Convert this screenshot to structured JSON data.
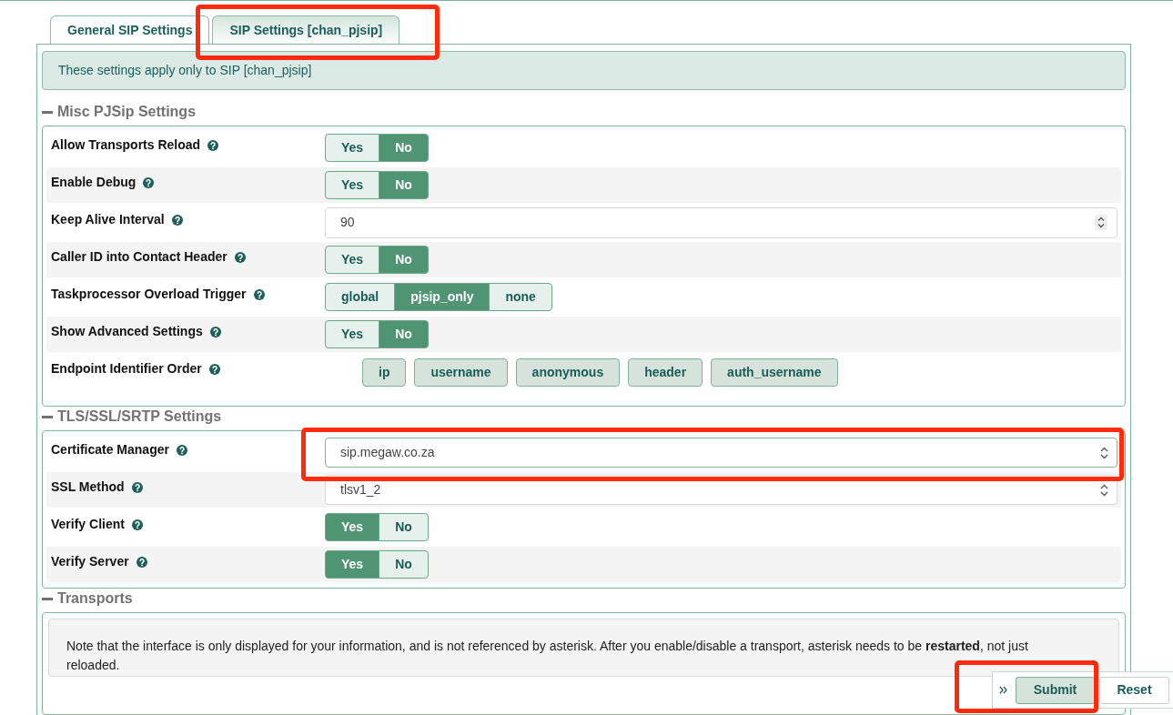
{
  "tabs": [
    {
      "label": "General SIP Settings",
      "selected": false,
      "highlighted": false
    },
    {
      "label": "SIP Settings [chan_pjsip]",
      "selected": true,
      "highlighted": true
    }
  ],
  "info_message": "These settings apply only to SIP [chan_pjsip]",
  "sections": [
    {
      "title": "Misc PJSip Settings",
      "expanded": true,
      "rows": [
        {
          "kind": "toggle",
          "label": "Allow Transports Reload",
          "highlighted": false,
          "options": [
            {
              "label": "Yes",
              "selected": false
            },
            {
              "label": "No",
              "selected": true
            }
          ]
        },
        {
          "kind": "toggle",
          "label": "Enable Debug",
          "highlighted": false,
          "options": [
            {
              "label": "Yes",
              "selected": false
            },
            {
              "label": "No",
              "selected": true
            }
          ]
        },
        {
          "kind": "number",
          "label": "Keep Alive Interval",
          "highlighted": false,
          "value": "90",
          "focused": false
        },
        {
          "kind": "toggle",
          "label": "Caller ID into Contact Header",
          "highlighted": false,
          "options": [
            {
              "label": "Yes",
              "selected": false
            },
            {
              "label": "No",
              "selected": true
            }
          ]
        },
        {
          "kind": "toggle",
          "label": "Taskprocessor Overload Trigger",
          "highlighted": false,
          "options": [
            {
              "label": "global",
              "selected": false
            },
            {
              "label": "pjsip_only",
              "selected": true
            },
            {
              "label": "none",
              "selected": false
            }
          ]
        },
        {
          "kind": "toggle",
          "label": "Show Advanced Settings",
          "highlighted": false,
          "options": [
            {
              "label": "Yes",
              "selected": false
            },
            {
              "label": "No",
              "selected": true
            }
          ]
        },
        {
          "kind": "order",
          "label": "Endpoint Identifier Order",
          "highlighted": false,
          "items": [
            "ip",
            "username",
            "anonymous",
            "header",
            "auth_username"
          ]
        }
      ]
    },
    {
      "title": "TLS/SSL/SRTP Settings",
      "expanded": true,
      "rows": [
        {
          "kind": "select",
          "label": "Certificate Manager",
          "highlighted": true,
          "value": "sip.megaw.co.za",
          "focused": true
        },
        {
          "kind": "select",
          "label": "SSL Method",
          "highlighted": false,
          "value": "tlsv1_2",
          "focused": false
        },
        {
          "kind": "toggle",
          "label": "Verify Client",
          "highlighted": false,
          "options": [
            {
              "label": "Yes",
              "selected": true
            },
            {
              "label": "No",
              "selected": false
            }
          ]
        },
        {
          "kind": "toggle",
          "label": "Verify Server",
          "highlighted": false,
          "options": [
            {
              "label": "Yes",
              "selected": true
            },
            {
              "label": "No",
              "selected": false
            }
          ]
        }
      ]
    },
    {
      "title": "Transports",
      "expanded": true,
      "note": "Note that the interface is only displayed for your information, and is not referenced by asterisk. After you enable/disable a transport, asterisk needs to be **restarted**, not just reloaded."
    }
  ],
  "actions": [
    {
      "kind": "primary",
      "label": "Submit",
      "highlighted": true
    },
    {
      "kind": "secondary",
      "label": "Reset",
      "highlighted": false
    }
  ]
}
